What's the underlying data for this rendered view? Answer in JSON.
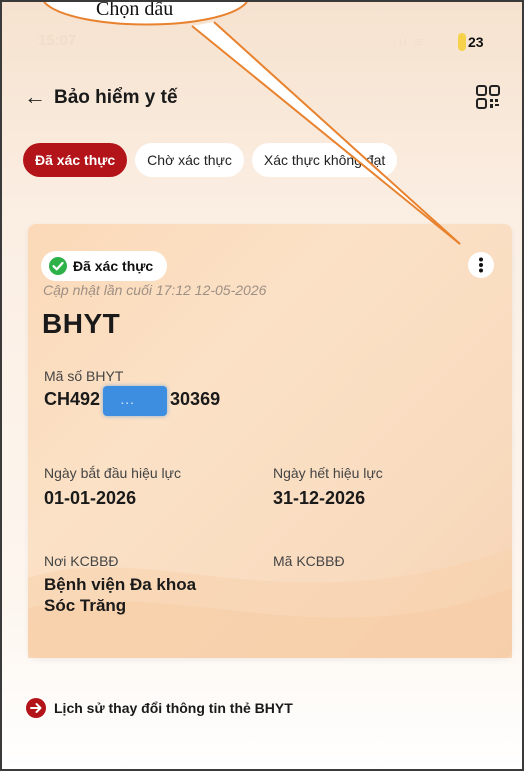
{
  "status_bar": {
    "time": "15:07",
    "battery": "23"
  },
  "header": {
    "title": "Bảo hiểm y tế"
  },
  "tabs": [
    {
      "label": "Đã xác thực",
      "active": true
    },
    {
      "label": "Chờ xác thực",
      "active": false
    },
    {
      "label": "Xác thực không đạt",
      "active": false
    }
  ],
  "card": {
    "badge": "Đã xác thực",
    "updated": "Cập nhật lần cuối 17:12 12-05-2026",
    "title": "BHYT",
    "id_label": "Mã số BHYT",
    "id_prefix": "CH492",
    "id_suffix": "30369",
    "start_label": "Ngày bắt đầu hiệu lực",
    "start_value": "01-01-2026",
    "end_label": "Ngày hết hiệu lực",
    "end_value": "31-12-2026",
    "place_label": "Nơi KCBBĐ",
    "place_value_1": "Bệnh viện Đa khoa",
    "place_value_2": "Sóc Trăng",
    "code_label": "Mã KCBBĐ"
  },
  "history": {
    "label": "Lịch sử thay đổi thông tin thẻ BHYT"
  },
  "callout": {
    "text": "Chọn dấu"
  },
  "colors": {
    "accent": "#b3141a",
    "verified": "#2fb14a",
    "mask": "#3d8ee0",
    "callout_line": "#e8822e"
  }
}
